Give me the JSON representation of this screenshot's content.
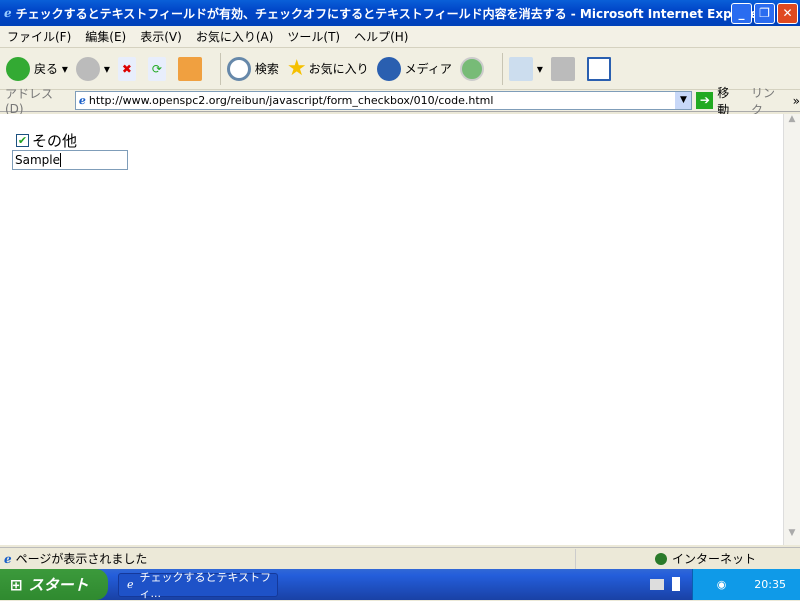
{
  "window": {
    "title": "チェックするとテキストフィールドが有効、チェックオフにするとテキストフィールド内容を消去する - Microsoft Internet Explorer",
    "minimize": "_",
    "restore": "❐",
    "close": "✕"
  },
  "menu": [
    "ファイル(F)",
    "編集(E)",
    "表示(V)",
    "お気に入り(A)",
    "ツール(T)",
    "ヘルプ(H)"
  ],
  "toolbar": {
    "back": "戻る",
    "search": "検索",
    "favorites": "お気に入り",
    "media": "メディア"
  },
  "address": {
    "label": "アドレス(D)",
    "url": "http://www.openspc2.org/reibun/javascript/form_checkbox/010/code.html",
    "go": "移動",
    "links": "リンク"
  },
  "page": {
    "checkbox_label": "その他",
    "checked": true,
    "text_value": "Sample"
  },
  "status": {
    "text": "ページが表示されました",
    "zone": "インターネット"
  },
  "taskbar": {
    "start": "スタート",
    "task": "チェックするとテキストフィ...",
    "clock": "20:35"
  }
}
